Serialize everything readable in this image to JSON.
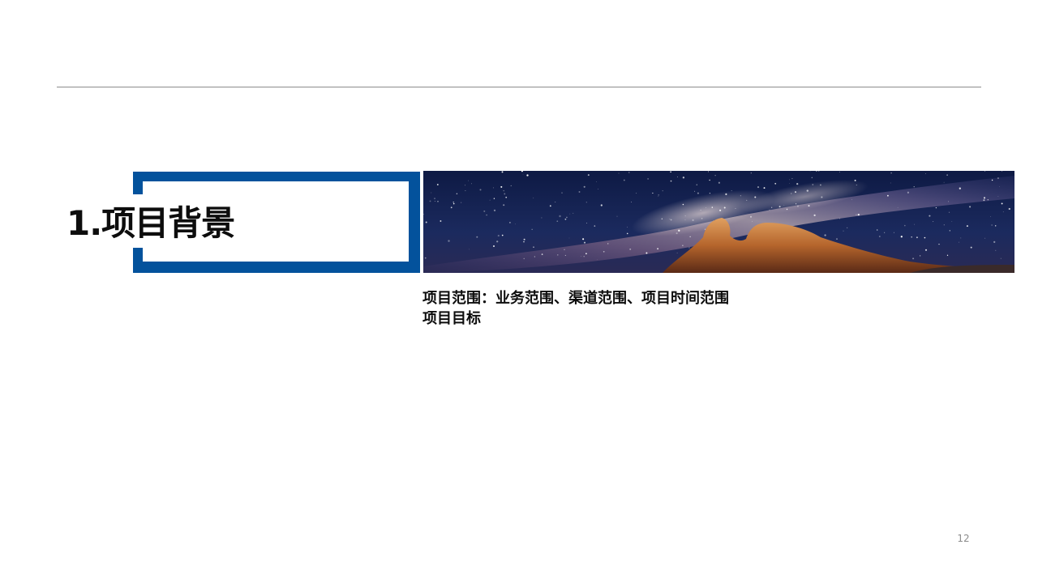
{
  "section": {
    "title": "1.项目背景"
  },
  "content": {
    "lines": [
      "项目范围：业务范围、渠道范围、项目时间范围",
      "项目目标"
    ]
  },
  "image": {
    "icon": "night-sky-milky-way-rock-photo"
  },
  "footer": {
    "page_number": "12"
  },
  "colors": {
    "accent": "#03529c",
    "rule": "#8c8c8c",
    "text": "#0d0d0d"
  }
}
